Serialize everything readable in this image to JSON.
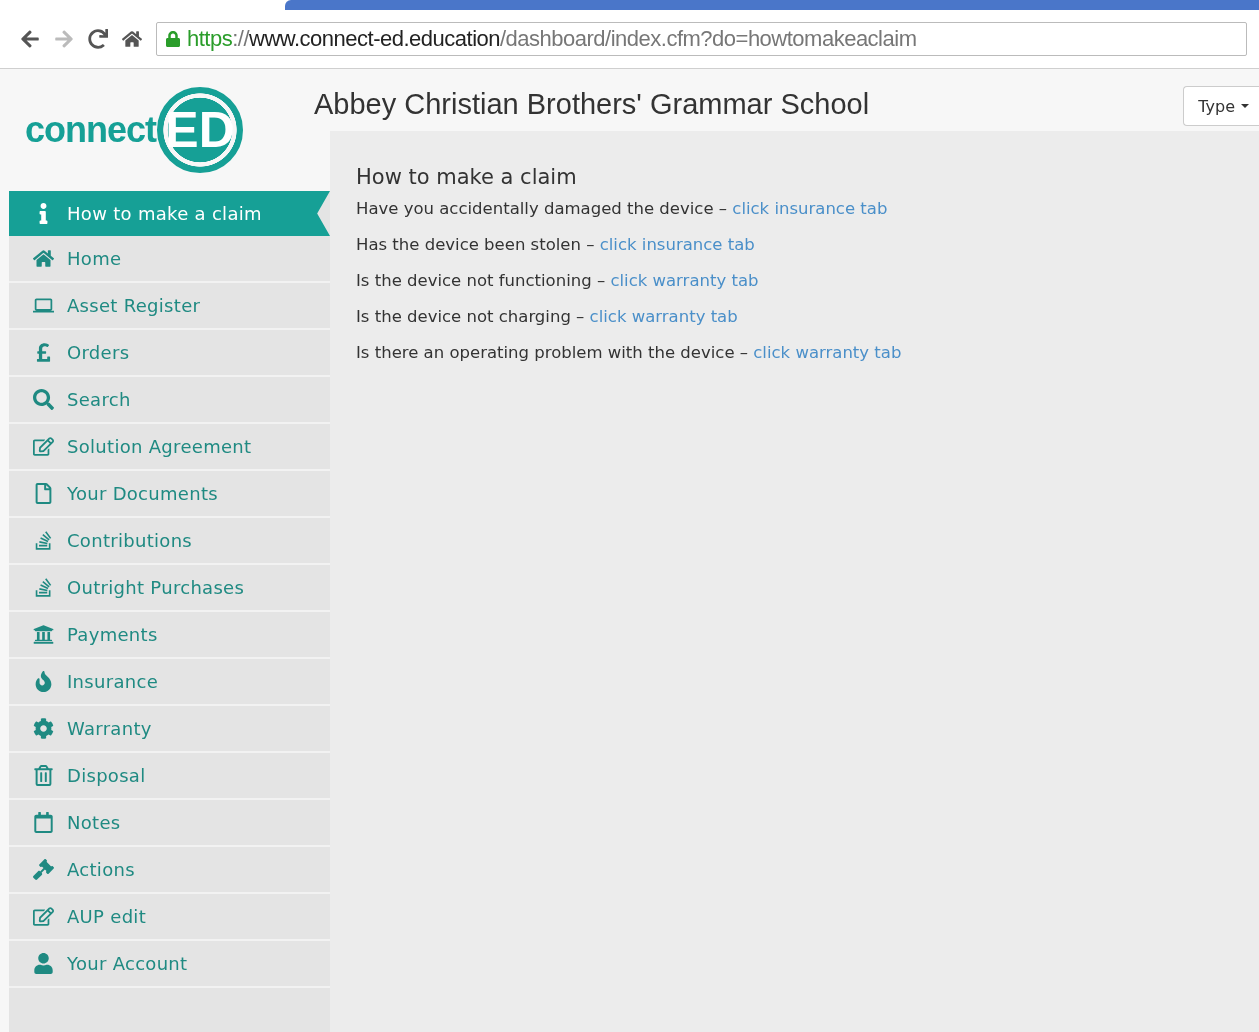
{
  "browser": {
    "url": [
      {
        "kind": "scheme",
        "text": "https"
      },
      {
        "kind": "separator",
        "text": "://"
      },
      {
        "kind": "host",
        "text": "www.connect-ed.education"
      },
      {
        "kind": "path",
        "text": "/dashboard/index.cfm?do=howtomakeaclaim"
      }
    ]
  },
  "logo": {
    "text": "connect",
    "mark": "ED"
  },
  "school_name": "Abbey Christian Brothers' Grammar School",
  "type_dropdown": {
    "label": "Type"
  },
  "sidebar": {
    "items": [
      {
        "label": "How to make a claim",
        "selected": true
      },
      {
        "label": "Home",
        "selected": false
      },
      {
        "label": "Asset Register",
        "selected": false
      },
      {
        "label": "Orders",
        "selected": false
      },
      {
        "label": "Search",
        "selected": false
      },
      {
        "label": "Solution Agreement",
        "selected": false
      },
      {
        "label": "Your Documents",
        "selected": false
      },
      {
        "label": "Contributions",
        "selected": false
      },
      {
        "label": "Outright Purchases",
        "selected": false
      },
      {
        "label": "Payments",
        "selected": false
      },
      {
        "label": "Insurance",
        "selected": false
      },
      {
        "label": "Warranty",
        "selected": false
      },
      {
        "label": "Disposal",
        "selected": false
      },
      {
        "label": "Notes",
        "selected": false
      },
      {
        "label": "Actions",
        "selected": false
      },
      {
        "label": "AUP edit",
        "selected": false
      },
      {
        "label": "Your Account",
        "selected": false
      }
    ]
  },
  "content": {
    "heading": "How to make a claim",
    "steps": [
      {
        "question": "Have you accidentally damaged the device –",
        "link": "click insurance tab"
      },
      {
        "question": "Has the device been stolen –",
        "link": "click insurance tab"
      },
      {
        "question": "Is the device not functioning –",
        "link": "click warranty tab"
      },
      {
        "question": "Is the device not charging –",
        "link": "click warranty tab"
      },
      {
        "question": "Is there an operating problem with the device –",
        "link": "click warranty tab"
      }
    ]
  }
}
